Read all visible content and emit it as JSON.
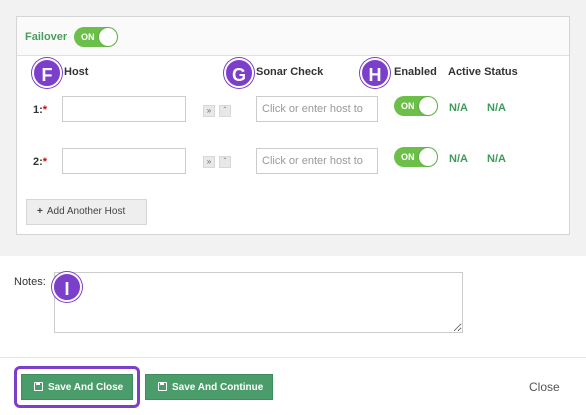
{
  "failover": {
    "label": "Failover",
    "toggle_label": "ON"
  },
  "columns": {
    "host": "Host",
    "sonar_check": "Sonar Check",
    "enabled": "Enabled",
    "active_status": "Active Status"
  },
  "markers": {
    "f": "F",
    "g": "G",
    "h": "H",
    "i": "I"
  },
  "rows": [
    {
      "label": "1:",
      "required": "*",
      "host_value": "",
      "sonar_placeholder": "Click or enter host to",
      "enabled_label": "ON",
      "status_a": "N/A",
      "status_b": "N/A"
    },
    {
      "label": "2:",
      "required": "*",
      "host_value": "",
      "sonar_placeholder": "Click or enter host to",
      "enabled_label": "ON",
      "status_a": "N/A",
      "status_b": "N/A"
    }
  ],
  "add_host_label": "Add Another Host",
  "notes": {
    "label": "Notes:",
    "value": ""
  },
  "footer": {
    "save_close": "Save And Close",
    "save_continue": "Save And Continue",
    "close": "Close"
  },
  "colors": {
    "accent_green": "#4a9d6b",
    "toggle_green": "#6cc04a",
    "marker_purple": "#7b3fc9"
  }
}
